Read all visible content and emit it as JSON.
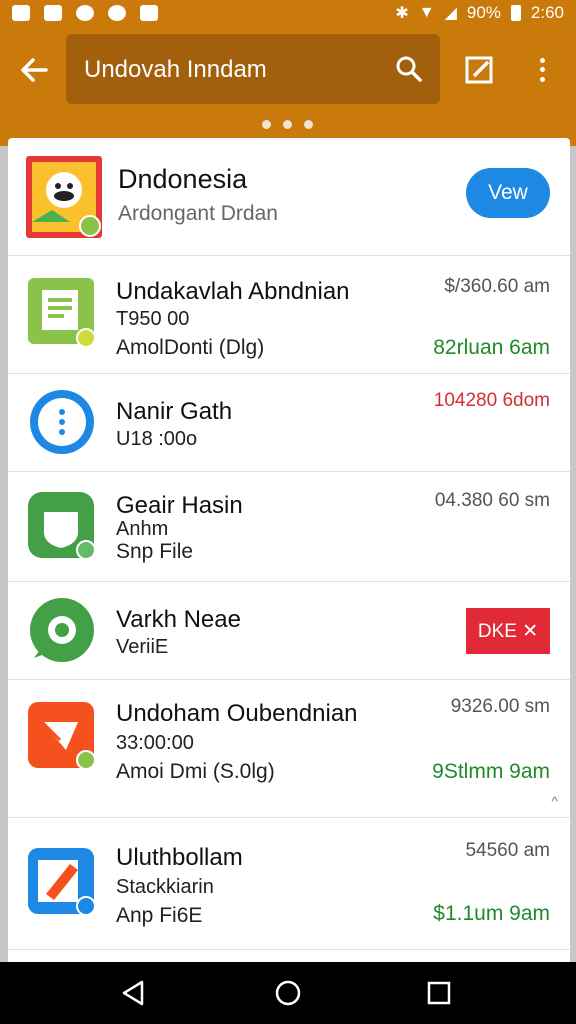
{
  "status_bar": {
    "battery": "90%",
    "time": "2:60"
  },
  "search": {
    "query": "Undovah Inndam"
  },
  "header": {
    "title": "Dndonesia",
    "subtitle": "Ardongant Drdan",
    "view_label": "Vew"
  },
  "items": [
    {
      "title": "Undakavlah Abndnian",
      "line2": "T950 00",
      "line3": "AmolDonti (Dlg)",
      "time": "$/360.60 am",
      "green": "82rluan 6am",
      "icon": "document-app-icon",
      "icon_color": "#8bc34a"
    },
    {
      "title": "Nanir Gath",
      "line2": "U18 :00o",
      "time": "104280 6dom",
      "icon": "info-app-icon",
      "icon_color": "#1e88e5"
    },
    {
      "title": "Geair Hasin",
      "line2": "Anhm",
      "line3": "Snp File",
      "time": "04.380 60 sm",
      "icon": "chat-app-icon",
      "icon_color": "#43a047"
    },
    {
      "title": "Varkh Neae",
      "line2": "VeriiE",
      "delete_label": "DKE ✕",
      "icon": "whatsapp-app-icon",
      "icon_color": "#43a047"
    },
    {
      "title": "Undoham Oubendnian",
      "line2": "33:00:00",
      "line3": "Amoi Dmi (S.0lg)",
      "time": "9326.00 sm",
      "green": "9Stlmm 9am",
      "icon": "mail-app-icon",
      "icon_color": "#f4511e"
    },
    {
      "title": "Uluthbollam",
      "line2": "Stackkiarin",
      "line3": "Anp Fi6E",
      "time": "54560 am",
      "green": "$1.1um 9am",
      "icon": "pencil-app-icon",
      "icon_color": "#1e88e5"
    }
  ]
}
